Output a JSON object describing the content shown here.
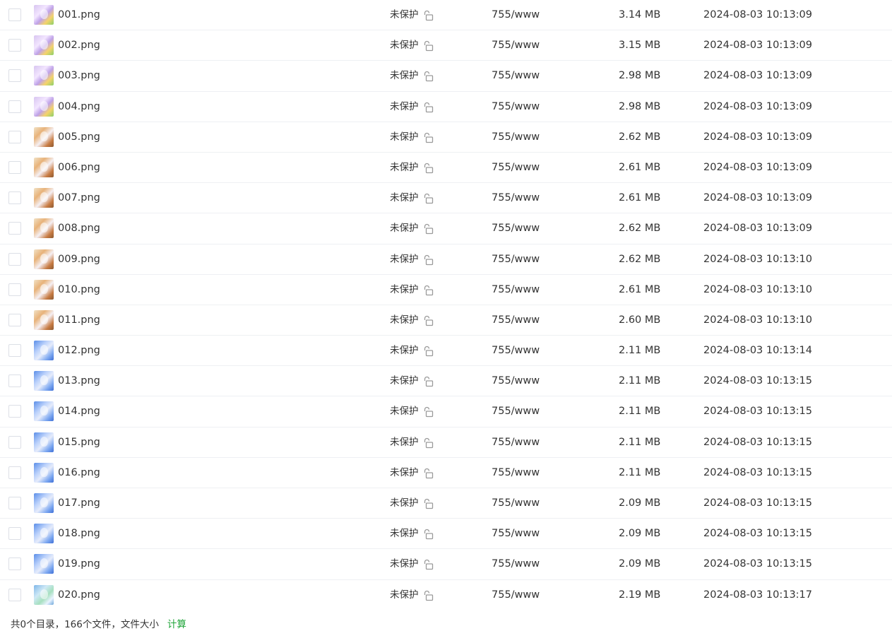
{
  "files": [
    {
      "name": "001.png",
      "protect": "未保护",
      "perm": "755/www",
      "size": "3.14 MB",
      "mtime": "2024-08-03 10:13:09",
      "thumb": "a"
    },
    {
      "name": "002.png",
      "protect": "未保护",
      "perm": "755/www",
      "size": "3.15 MB",
      "mtime": "2024-08-03 10:13:09",
      "thumb": "a"
    },
    {
      "name": "003.png",
      "protect": "未保护",
      "perm": "755/www",
      "size": "2.98 MB",
      "mtime": "2024-08-03 10:13:09",
      "thumb": "a"
    },
    {
      "name": "004.png",
      "protect": "未保护",
      "perm": "755/www",
      "size": "2.98 MB",
      "mtime": "2024-08-03 10:13:09",
      "thumb": "a"
    },
    {
      "name": "005.png",
      "protect": "未保护",
      "perm": "755/www",
      "size": "2.62 MB",
      "mtime": "2024-08-03 10:13:09",
      "thumb": "b"
    },
    {
      "name": "006.png",
      "protect": "未保护",
      "perm": "755/www",
      "size": "2.61 MB",
      "mtime": "2024-08-03 10:13:09",
      "thumb": "b"
    },
    {
      "name": "007.png",
      "protect": "未保护",
      "perm": "755/www",
      "size": "2.61 MB",
      "mtime": "2024-08-03 10:13:09",
      "thumb": "b"
    },
    {
      "name": "008.png",
      "protect": "未保护",
      "perm": "755/www",
      "size": "2.62 MB",
      "mtime": "2024-08-03 10:13:09",
      "thumb": "b"
    },
    {
      "name": "009.png",
      "protect": "未保护",
      "perm": "755/www",
      "size": "2.62 MB",
      "mtime": "2024-08-03 10:13:10",
      "thumb": "b"
    },
    {
      "name": "010.png",
      "protect": "未保护",
      "perm": "755/www",
      "size": "2.61 MB",
      "mtime": "2024-08-03 10:13:10",
      "thumb": "b"
    },
    {
      "name": "011.png",
      "protect": "未保护",
      "perm": "755/www",
      "size": "2.60 MB",
      "mtime": "2024-08-03 10:13:10",
      "thumb": "b"
    },
    {
      "name": "012.png",
      "protect": "未保护",
      "perm": "755/www",
      "size": "2.11 MB",
      "mtime": "2024-08-03 10:13:14",
      "thumb": "c"
    },
    {
      "name": "013.png",
      "protect": "未保护",
      "perm": "755/www",
      "size": "2.11 MB",
      "mtime": "2024-08-03 10:13:15",
      "thumb": "c"
    },
    {
      "name": "014.png",
      "protect": "未保护",
      "perm": "755/www",
      "size": "2.11 MB",
      "mtime": "2024-08-03 10:13:15",
      "thumb": "c"
    },
    {
      "name": "015.png",
      "protect": "未保护",
      "perm": "755/www",
      "size": "2.11 MB",
      "mtime": "2024-08-03 10:13:15",
      "thumb": "c"
    },
    {
      "name": "016.png",
      "protect": "未保护",
      "perm": "755/www",
      "size": "2.11 MB",
      "mtime": "2024-08-03 10:13:15",
      "thumb": "c"
    },
    {
      "name": "017.png",
      "protect": "未保护",
      "perm": "755/www",
      "size": "2.09 MB",
      "mtime": "2024-08-03 10:13:15",
      "thumb": "c"
    },
    {
      "name": "018.png",
      "protect": "未保护",
      "perm": "755/www",
      "size": "2.09 MB",
      "mtime": "2024-08-03 10:13:15",
      "thumb": "c"
    },
    {
      "name": "019.png",
      "protect": "未保护",
      "perm": "755/www",
      "size": "2.09 MB",
      "mtime": "2024-08-03 10:13:15",
      "thumb": "c"
    },
    {
      "name": "020.png",
      "protect": "未保护",
      "perm": "755/www",
      "size": "2.19 MB",
      "mtime": "2024-08-03 10:13:17",
      "thumb": "d"
    }
  ],
  "footer": {
    "summary": "共0个目录，166个文件，文件大小",
    "calc_label": "计算"
  },
  "colors": {
    "accent_green": "#20a53a",
    "text": "#333333",
    "row_border": "#eef0f3",
    "checkbox_border": "#dcdfe6"
  },
  "icons": {
    "protect": "unlock-icon",
    "thumb": "image-thumbnail-icon"
  }
}
